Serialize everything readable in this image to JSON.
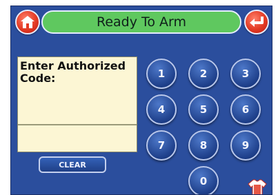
{
  "header": {
    "status_text": "Ready To Arm",
    "home_button_icon": "home-icon",
    "back_button_icon": "return-arrow-icon"
  },
  "prompt": {
    "text": "Enter Authorized Code:",
    "entered_code": ""
  },
  "clear_label": "CLEAR",
  "keypad": {
    "keys": [
      "1",
      "2",
      "3",
      "4",
      "5",
      "6",
      "7",
      "8",
      "9",
      "0"
    ]
  },
  "footer": {
    "corner_icon": "shirt-icon"
  },
  "colors": {
    "screen_bg": "#2b4e9d",
    "status_green": "#5fc85f",
    "prompt_bg": "#fcf6d4",
    "accent_red": "#e33a24"
  }
}
